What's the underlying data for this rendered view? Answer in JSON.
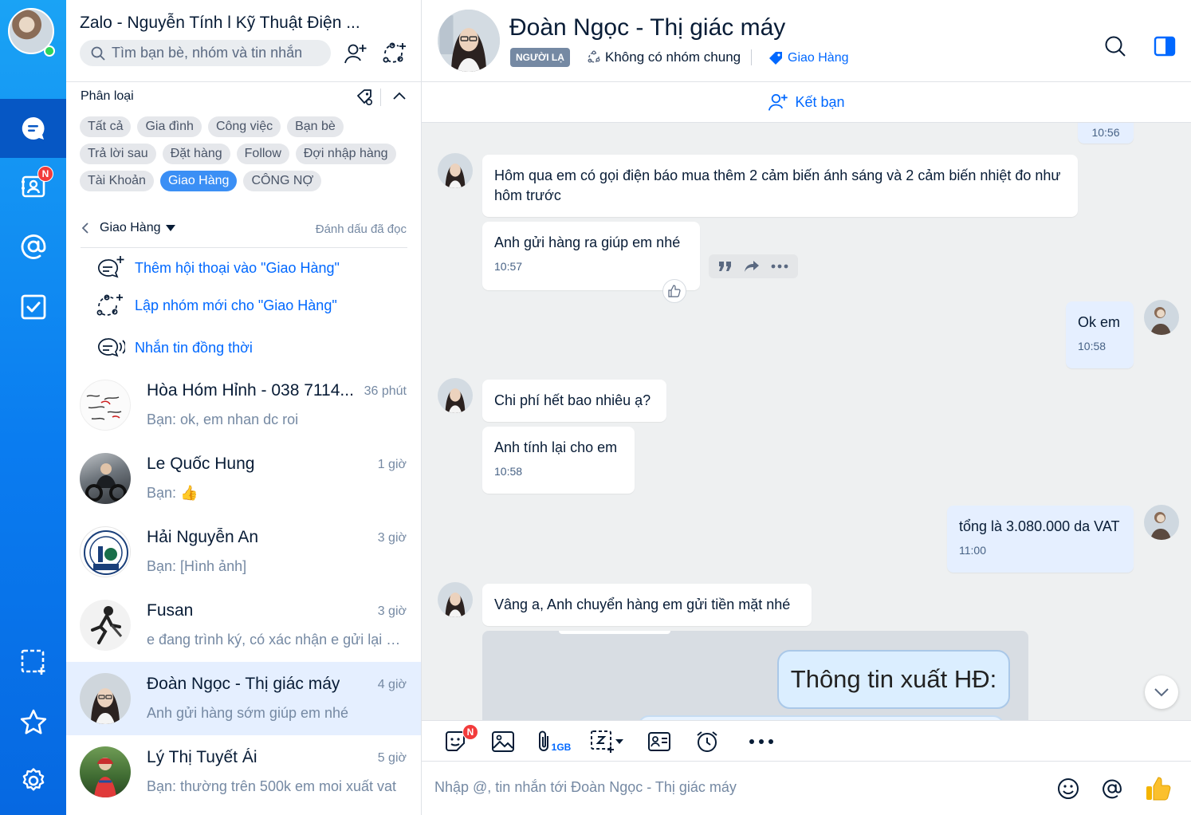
{
  "colors": {
    "accent": "#0068ff",
    "rail": "#0a7cf0",
    "badge": "#f23b3b",
    "online": "#2bd45b",
    "selected_chip": "#3b8ff5"
  },
  "rail": {
    "contacts_badge": "N"
  },
  "list": {
    "app_title": "Zalo - Nguyễn Tính l Kỹ Thuật Điện ...",
    "search_placeholder": "Tìm bạn bè, nhóm và tin nhắn",
    "category_title": "Phân loại",
    "chips": [
      [
        "Tất cả",
        "Gia đình",
        "Công việc",
        "Bạn bè"
      ],
      [
        "Trả lời sau",
        "Đặt hàng",
        "Follow",
        "Đợi nhập hàng"
      ],
      [
        "Tài Khoản",
        "Giao Hàng",
        "CÔNG NỢ"
      ]
    ],
    "selected_chip": "Giao Hàng",
    "filter_label": "Giao Hàng",
    "mark_read": "Đánh dấu đã đọc",
    "actions": [
      {
        "label": "Thêm hội thoại vào \"Giao Hàng\"",
        "icon": "add-chat-icon"
      },
      {
        "label": "Lập nhóm mới cho \"Giao Hàng\"",
        "icon": "create-group-icon"
      },
      {
        "label": "Nhắn tin đồng thời",
        "icon": "broadcast-icon"
      }
    ],
    "conversations": [
      {
        "name": "Hòa Hóm Hỉnh - 038 7114...",
        "time": "36 phút",
        "preview": "Bạn: ok, em nhan dc roi"
      },
      {
        "name": "Le Quốc Hung",
        "time": "1 giờ",
        "preview": "Bạn: 👍"
      },
      {
        "name": "Hải Nguyễn An",
        "time": "3 giờ",
        "preview": "Bạn: [Hình ảnh]"
      },
      {
        "name": "Fusan",
        "time": "3 giờ",
        "preview": "e đang trình ký, có xác nhận e gửi lại a s..."
      },
      {
        "name": "Đoàn Ngọc - Thị giác máy",
        "time": "4 giờ",
        "preview": "Anh gửi hàng sớm giúp em nhé"
      },
      {
        "name": "Lý Thị Tuyết Ái",
        "time": "5 giờ",
        "preview": "Bạn: thường trên 500k em moi xuất vat"
      }
    ]
  },
  "chat": {
    "name": "Đoàn Ngọc - Thị giác máy",
    "stranger_badge": "NGƯỜI LẠ",
    "no_common_group": "Không có nhóm chung",
    "tag": "Giao Hàng",
    "add_friend": "Kết bạn",
    "top_partial_time": "10:56",
    "messages": {
      "m1": "Hôm qua em có gọi điện báo mua thêm 2 cảm biến ánh sáng và 2 cảm biến nhiệt đo như hôm trước",
      "m2": "Anh gửi hàng ra giúp em nhé",
      "m2_time": "10:57",
      "m3": "Ok em",
      "m3_time": "10:58",
      "m4": "Chi phí hết bao nhiêu ạ?",
      "m5": "Anh tính lại cho em",
      "m5_time": "10:58",
      "m6": "tổng là 3.080.000 da VAT",
      "m6_time": "11:00",
      "m7": "Vâng a, Anh chuyển hàng em gửi tiền mặt nhé",
      "image_text": "Thông tin xuất HĐ:"
    },
    "toolbar": {
      "sticker_badge": "N",
      "file_size": "1GB"
    },
    "composer_placeholder": "Nhập @, tin nhắn tới Đoàn Ngọc - Thị giác máy"
  }
}
